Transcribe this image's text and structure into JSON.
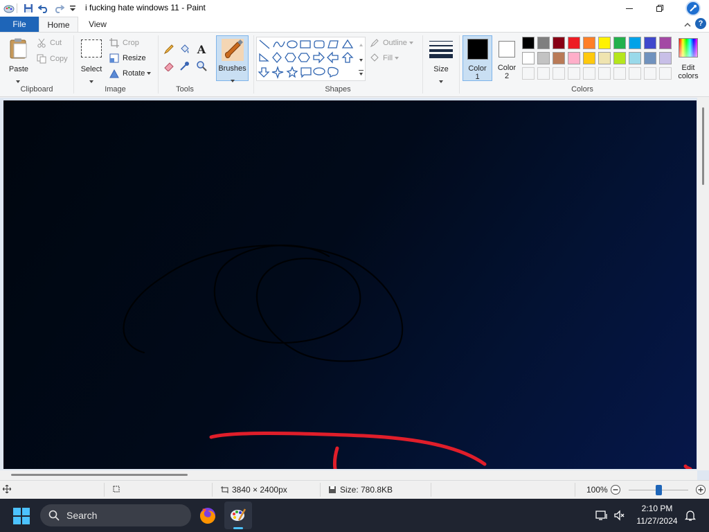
{
  "window": {
    "title": "i fucking hate windows 11 - Paint",
    "minimize_label": "—",
    "maximize_label": "❐",
    "close_icon": "avatar-icon"
  },
  "tabs": [
    {
      "label": "File"
    },
    {
      "label": "Home"
    },
    {
      "label": "View"
    }
  ],
  "help_label": "?",
  "ribbon": {
    "clipboard": {
      "label": "Clipboard",
      "paste": "Paste",
      "cut": "Cut",
      "copy": "Copy"
    },
    "image": {
      "label": "Image",
      "select": "Select",
      "crop": "Crop",
      "resize": "Resize",
      "rotate": "Rotate"
    },
    "tools": {
      "label": "Tools"
    },
    "brushes": {
      "label": "Brushes"
    },
    "shapes": {
      "label": "Shapes",
      "outline": "Outline",
      "fill": "Fill"
    },
    "size": {
      "label": "Size"
    },
    "color1": {
      "label_line1": "Color",
      "label_line2": "1",
      "value": "#000000"
    },
    "color2": {
      "label_line1": "Color",
      "label_line2": "2",
      "value": "#ffffff"
    },
    "colors": {
      "label": "Colors",
      "edit_line1": "Edit",
      "edit_line2": "colors",
      "row1": [
        "#000000",
        "#7f7f7f",
        "#880015",
        "#ed1c24",
        "#ff7f27",
        "#fff200",
        "#22b14c",
        "#00a2e8",
        "#3f48cc",
        "#a349a4"
      ],
      "row2": [
        "#ffffff",
        "#c3c3c3",
        "#b97a57",
        "#ffaec9",
        "#ffc90e",
        "#efe4b0",
        "#b5e61d",
        "#99d9ea",
        "#7092be",
        "#c8bfe7"
      ]
    }
  },
  "status": {
    "dimensions": "3840 × 2400px",
    "size": "Size: 780.8KB",
    "zoom": "100%",
    "zoom_level": 0.5
  },
  "taskbar": {
    "search": "Search",
    "time": "2:10 PM",
    "date": "11/27/2024"
  }
}
